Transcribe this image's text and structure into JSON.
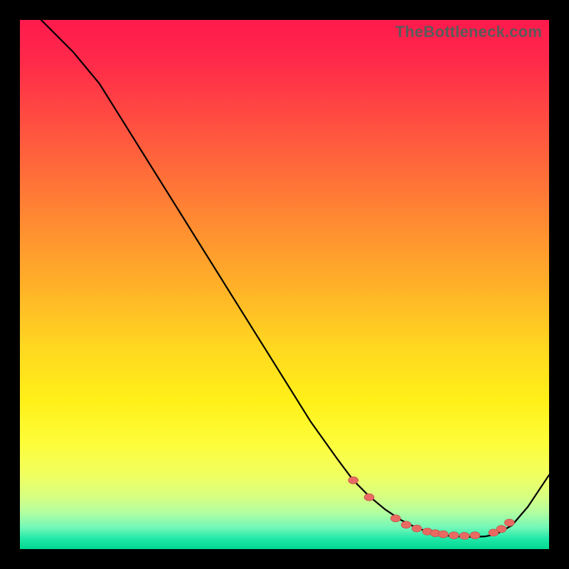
{
  "watermark": "TheBottleneck.com",
  "colors": {
    "dot_fill": "#e96a62",
    "dot_stroke": "#b84a42",
    "line": "#000000"
  },
  "chart_data": {
    "type": "line",
    "title": "",
    "xlabel": "",
    "ylabel": "",
    "xlim": [
      0,
      100
    ],
    "ylim": [
      0,
      100
    ],
    "grid": false,
    "legend": false,
    "series": [
      {
        "name": "curve",
        "x": [
          4,
          10,
          15,
          20,
          25,
          30,
          35,
          40,
          45,
          50,
          55,
          60,
          63,
          66,
          69,
          72,
          75,
          78,
          81,
          84,
          86,
          88,
          90,
          93,
          96,
          100
        ],
        "y": [
          100,
          94,
          88,
          80,
          72,
          64,
          56,
          48,
          40,
          32,
          24,
          17,
          13,
          10,
          7.5,
          5.5,
          4,
          3,
          2.5,
          2.3,
          2.3,
          2.4,
          2.8,
          4.5,
          8,
          14
        ]
      }
    ],
    "dots": [
      {
        "x": 63,
        "y": 13
      },
      {
        "x": 66,
        "y": 9.8
      },
      {
        "x": 71,
        "y": 5.8
      },
      {
        "x": 73,
        "y": 4.6
      },
      {
        "x": 75,
        "y": 3.9
      },
      {
        "x": 77,
        "y": 3.3
      },
      {
        "x": 78.5,
        "y": 3.0
      },
      {
        "x": 80,
        "y": 2.8
      },
      {
        "x": 82,
        "y": 2.6
      },
      {
        "x": 84,
        "y": 2.5
      },
      {
        "x": 86,
        "y": 2.6
      },
      {
        "x": 89.5,
        "y": 3.1
      },
      {
        "x": 91,
        "y": 3.8
      },
      {
        "x": 92.5,
        "y": 5.0
      }
    ],
    "dot_rx": 7,
    "dot_ry": 5
  }
}
